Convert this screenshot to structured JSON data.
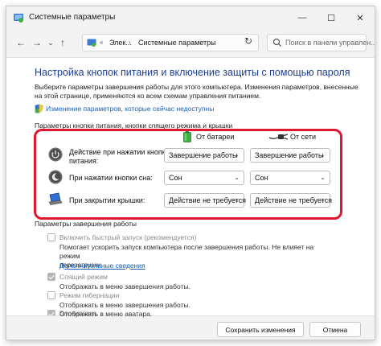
{
  "window": {
    "title": "Системные параметры",
    "controls": {
      "minimize": "—",
      "maximize": "☐",
      "close": "✕"
    }
  },
  "navbar": {
    "back": "←",
    "forward": "→",
    "recent": "⌄",
    "up": "↑",
    "breadcrumb_sep": "«",
    "crumb_sep": "›",
    "crumbs": [
      "Элек...",
      "Системные параметры"
    ],
    "dropdown": "⌄",
    "refresh": "↻",
    "search_placeholder": "Поиск в панели управлен..."
  },
  "content": {
    "heading": "Настройка кнопок питания и включение защиты с помощью пароля",
    "description": "Выберите параметры завершения работы для этого компьютера. Изменения параметров, внесенные на этой странице, применяются ко всем схемам управления питанием.",
    "change_link": "Изменение параметров, которые сейчас недоступны",
    "power_section_label": "Параметры кнопки питания, кнопки спящего режима и крышки",
    "columns": {
      "battery": "От батареи",
      "plugged": "От сети"
    },
    "rows": [
      {
        "label_line1": "Действие при нажатии кнопки",
        "label_line2": "питания:",
        "battery": "Завершение работы",
        "plugged": "Завершение работы"
      },
      {
        "label_line1": "При нажатии кнопки сна:",
        "label_line2": "",
        "battery": "Сон",
        "plugged": "Сон"
      },
      {
        "label_line1": "При закрытии крышки:",
        "label_line2": "",
        "battery": "Действие не требуется",
        "plugged": "Действие не требуется"
      }
    ],
    "dropdown_arrow": "⌄",
    "shutdown_section_label": "Параметры завершения работы",
    "shutdown_options": [
      {
        "label": "Включить быстрый запуск (рекомендуется)",
        "checked": false,
        "desc_line1": "Помогает ускорить запуск компьютера после завершения работы. Не влияет на режим",
        "desc_line2": "перезагрузки.",
        "more": "Дополнительные сведения"
      },
      {
        "label": "Спящий режим",
        "checked": true,
        "desc_line1": "Отображать в меню завершения работы."
      },
      {
        "label": "Режим гибернации",
        "checked": false,
        "desc_line1": "Отображать в меню завершения работы."
      },
      {
        "label": "Блокировка",
        "checked": true,
        "desc_line1": "Отображать в меню аватара."
      }
    ]
  },
  "footer": {
    "save": "Сохранить изменения",
    "cancel": "Отмена"
  },
  "colors": {
    "heading": "#1e3d8f",
    "link": "#1a5fb4",
    "highlight": "#e0182d",
    "battery": "#3fae3f"
  }
}
